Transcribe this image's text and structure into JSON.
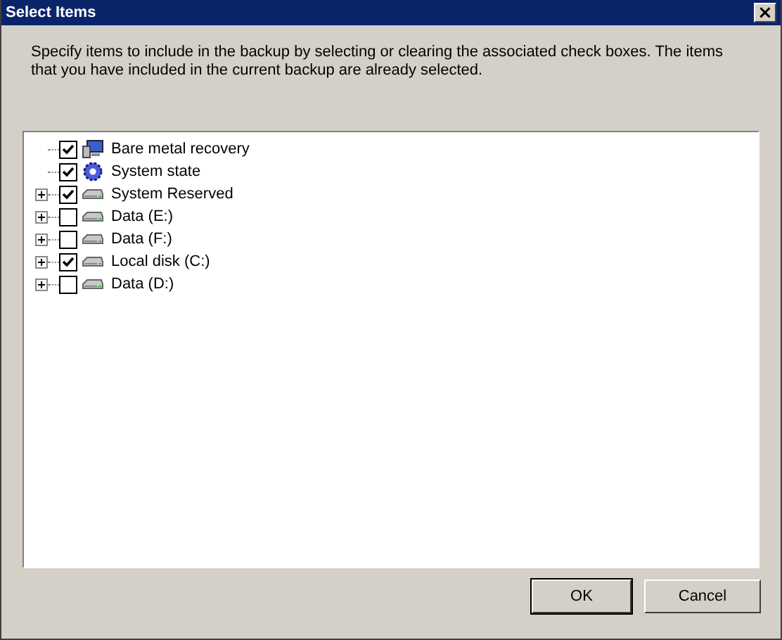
{
  "window": {
    "title": "Select Items",
    "close_glyph": "×"
  },
  "instructions": "Specify items to include in the backup by selecting or clearing the associated check boxes. The items that you have included in the current backup are already selected.",
  "tree": [
    {
      "label": "Bare metal recovery",
      "kind": "recovery",
      "expandable": false,
      "checked": true
    },
    {
      "label": "System state",
      "kind": "system",
      "expandable": false,
      "checked": true
    },
    {
      "label": "System Reserved",
      "kind": "drive",
      "expandable": true,
      "checked": true
    },
    {
      "label": "Data (E:)",
      "kind": "drive",
      "expandable": true,
      "checked": false
    },
    {
      "label": "Data (F:)",
      "kind": "drive",
      "expandable": true,
      "checked": false
    },
    {
      "label": "Local disk (C:)",
      "kind": "drive",
      "expandable": true,
      "checked": true
    },
    {
      "label": "Data (D:)",
      "kind": "drive",
      "expandable": true,
      "checked": false
    }
  ],
  "buttons": [
    {
      "label": "OK",
      "default": true
    },
    {
      "label": "Cancel",
      "default": false
    }
  ]
}
